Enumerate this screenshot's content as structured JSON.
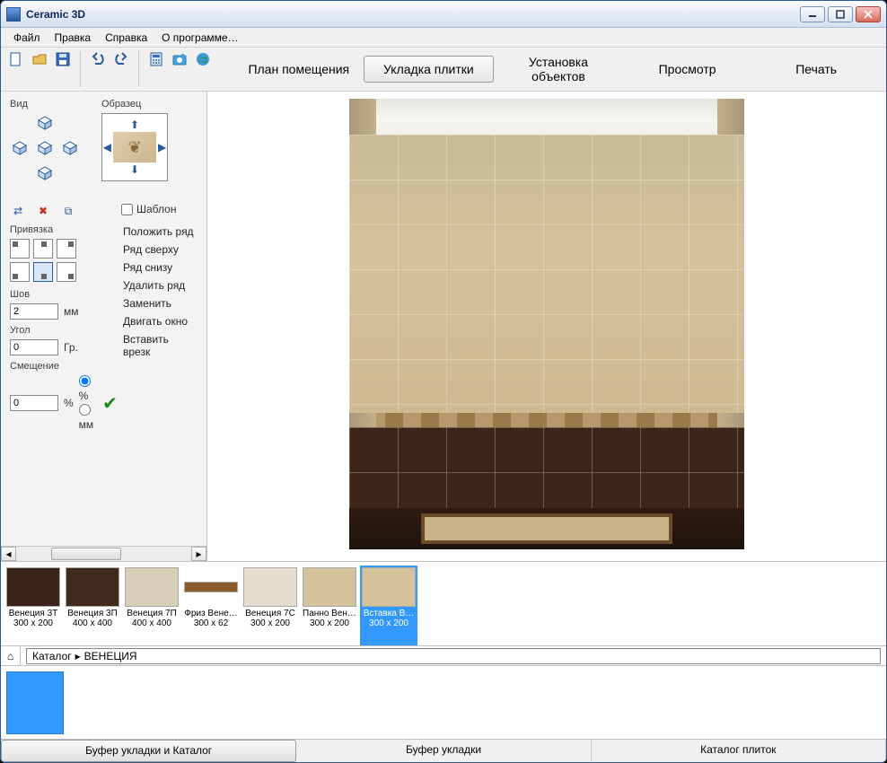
{
  "window": {
    "title": "Ceramic 3D"
  },
  "menu": {
    "file": "Файл",
    "edit": "Правка",
    "help": "Справка",
    "about": "О программе…"
  },
  "main_tabs": {
    "plan": "План помещения",
    "tiling": "Укладка плитки",
    "objects": "Установка объектов",
    "view": "Просмотр",
    "print": "Печать"
  },
  "panel": {
    "view_label": "Вид",
    "sample_label": "Образец",
    "template_label": "Шаблон",
    "binding_label": "Привязка",
    "seam_label": "Шов",
    "seam_value": "2",
    "seam_unit": "мм",
    "angle_label": "Угол",
    "angle_value": "0",
    "angle_unit": "Гр.",
    "offset_label": "Смещение",
    "offset_value": "0",
    "offset_percent": "%",
    "unit_percent": "%",
    "unit_mm": "мм",
    "btn_lay_row": "Положить ряд",
    "btn_row_above": "Ряд сверху",
    "btn_row_below": "Ряд снизу",
    "btn_delete_row": "Удалить ряд",
    "btn_replace": "Заменить",
    "btn_move_window": "Двигать окно",
    "btn_insert_cut": "Вставить врезк"
  },
  "breadcrumb": {
    "root": "Каталог",
    "current": "ВЕНЕЦИЯ",
    "sep": "▸"
  },
  "tiles": [
    {
      "name": "Венеция 3Т",
      "size": "300 x 200",
      "color": "#3a2318"
    },
    {
      "name": "Венеция 3П",
      "size": "400 x 400",
      "color": "#3f2a1c"
    },
    {
      "name": "Венеция 7П",
      "size": "400 x 400",
      "color": "#d8ceb8"
    },
    {
      "name": "Фриз Вене…",
      "size": "300 x 62",
      "color": "#8a5a2a"
    },
    {
      "name": "Венеция 7С",
      "size": "300 x 200",
      "color": "#e4dccc"
    },
    {
      "name": "Панно Вен…",
      "size": "300 x 200",
      "color": "#d4c29b"
    },
    {
      "name": "Вставка В…",
      "size": "300 x 200",
      "color": "#d4c29b"
    }
  ],
  "bottom_tabs": {
    "buffer_catalog": "Буфер укладки и Каталог",
    "buffer": "Буфер укладки",
    "catalog": "Каталог плиток"
  }
}
